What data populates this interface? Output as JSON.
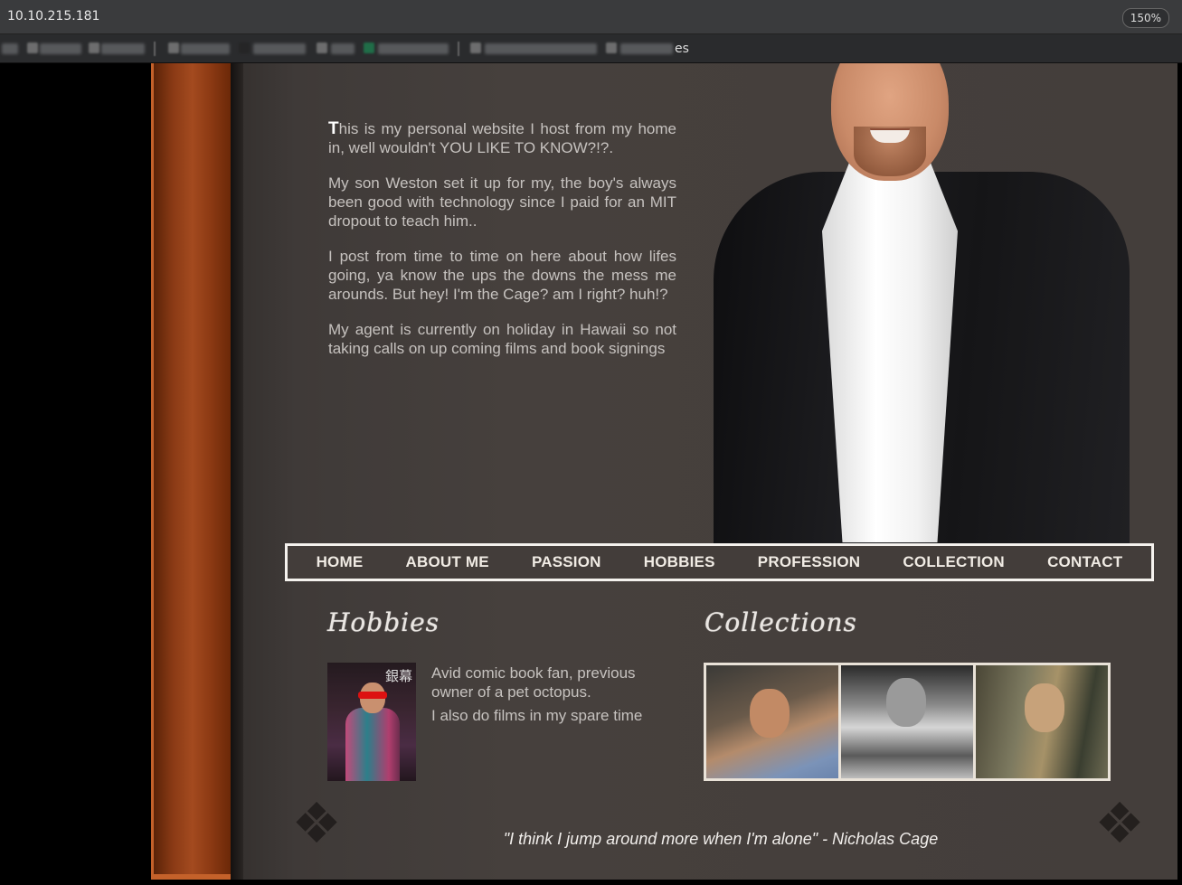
{
  "browser": {
    "url": "10.10.215.181",
    "zoom": "150%",
    "bookmarks_tail": "es"
  },
  "intro": {
    "dropcap": "T",
    "p1_rest": "his is my personal website I host from my home in, well wouldn't YOU LIKE TO KNOW?!?.",
    "p2": "My son Weston set it up for my, the boy's always been good with technology since I paid for an MIT dropout to teach him..",
    "p3": "I post from time to time on here about how lifes going, ya know the ups the downs the mess me arounds. But hey! I'm the Cage? am I right? huh!?",
    "p4": "My agent is currently on holiday in Hawaii so not taking calls on up coming films and book signings"
  },
  "nav": {
    "items": [
      "HOME",
      "ABOUT ME",
      "PASSION",
      "HOBBIES",
      "PROFESSION",
      "COLLECTION",
      "CONTACT"
    ]
  },
  "hobbies": {
    "heading": "Hobbies",
    "line1": "Avid comic book fan, previous owner of a pet octopus.",
    "line2": "I also do films in my spare time",
    "thumb_text": "銀幕"
  },
  "collections": {
    "heading": "Collections"
  },
  "quote": "\"I think I jump around more when I'm alone\" - Nicholas Cage"
}
